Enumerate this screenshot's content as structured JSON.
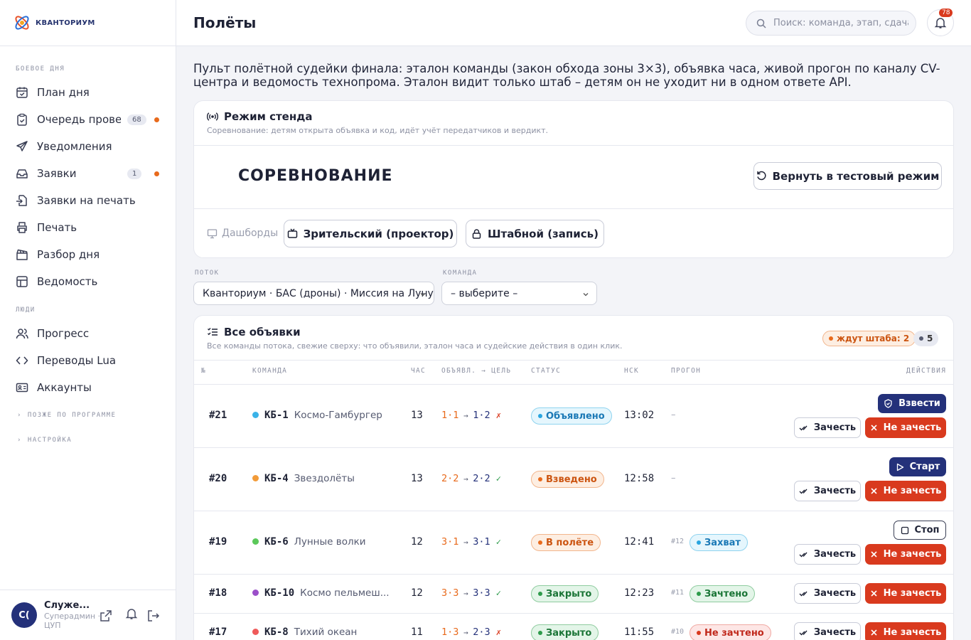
{
  "brand": {
    "name": "КВАНТОРИУМ"
  },
  "sidebar": {
    "section1": "БОЕВОЕ ДНЯ",
    "items1": [
      {
        "label": "План дня",
        "icon": "calendar-check-icon"
      },
      {
        "label": "Очередь проверок",
        "icon": "clipboard-check-icon",
        "count": "68",
        "dot": true
      },
      {
        "label": "Уведомления",
        "icon": "send-icon"
      },
      {
        "label": "Заявки",
        "icon": "inbox-icon",
        "count": "1",
        "dot": true
      },
      {
        "label": "Заявки на печать",
        "icon": "file-import-icon"
      },
      {
        "label": "Печать",
        "icon": "printer-icon"
      },
      {
        "label": "Разбор дня",
        "icon": "clapperboard-icon"
      },
      {
        "label": "Ведомость",
        "icon": "table-icon"
      }
    ],
    "section2": "ЛЮДИ",
    "items2": [
      {
        "label": "Прогресс",
        "icon": "users-icon"
      },
      {
        "label": "Переводы Lua",
        "icon": "code-icon"
      },
      {
        "label": "Аккаунты",
        "icon": "id-card-icon"
      }
    ],
    "collapsed": [
      "ПОЗЖЕ ПО ПРОГРАММЕ",
      "НАСТРОЙКА"
    ],
    "user": {
      "initials": "С(",
      "name": "Служе...",
      "role": "Суперадмин · ЦУП"
    }
  },
  "header": {
    "title": "Полёты",
    "search_placeholder": "Поиск: команда, этап, сдача",
    "notifications": "78"
  },
  "intro": "Пульт полётной судейки финала: эталон команды (закон обхода зоны 3×3), объявка часа, живой прогон по каналу CV-центра и ведомость технопрома. Эталон видит только штаб – детям он не уходит ни в одном ответе API.",
  "mode": {
    "title": "Режим стенда",
    "subtitle": "Соревнование: детям открыта объявка и код, идёт учёт передатчиков и вердикт.",
    "current": "СОРЕВНОВАНИЕ",
    "switch_label": "Вернуть в тестовый режим",
    "dashboards_label": "Дашборды",
    "dash_btn1": "Зрительский (проектор)",
    "dash_btn2": "Штабной (запись)"
  },
  "filters": {
    "stream_label": "ПОТОК",
    "stream_value": "Кванториум · БАС (дроны) · Миссия на Луну",
    "team_label": "КОМАНДА",
    "team_value": "– выберите –"
  },
  "table": {
    "title": "Все объявки",
    "subtitle": "Все команды потока, свежие сверху: что объявили, эталон часа и судейские действия в один клик.",
    "waiting_chip": "ждут штаба: 2",
    "count_chip": "5",
    "columns": [
      "№",
      "КОМАНДА",
      "ЧАС",
      "ОБЪЯВЛ. → ЦЕЛЬ",
      "СТАТУС",
      "НСК",
      "ПРОГОН",
      "ДЕЙСТВИЯ"
    ],
    "accept_label": "Зачесть",
    "reject_label": "Не зачесть",
    "rows": [
      {
        "num": "#21",
        "code": "КБ-1",
        "name": "Космо-Гамбургер",
        "color": "#3bb3e8",
        "hour": "13",
        "decl": "1·1",
        "target": "1·2",
        "mark": "✗",
        "status": "Объявлено",
        "status_class": "st-blue",
        "time": "13:02",
        "run": "–",
        "run_num": "",
        "run_status": "",
        "run_class": "",
        "action": "Взвести",
        "action_kind": "arm"
      },
      {
        "num": "#20",
        "code": "КБ-4",
        "name": "Звездолёты",
        "color": "#f29b38",
        "hour": "13",
        "decl": "2·2",
        "target": "2·2",
        "mark": "✓",
        "status": "Взведено",
        "status_class": "st-orange",
        "time": "12:58",
        "run": "–",
        "run_num": "",
        "run_status": "",
        "run_class": "",
        "action": "Старт",
        "action_kind": "start"
      },
      {
        "num": "#19",
        "code": "КБ-6",
        "name": "Лунные волки",
        "color": "#5bc85a",
        "hour": "12",
        "decl": "3·1",
        "target": "3·1",
        "mark": "✓",
        "status": "В полёте",
        "status_class": "st-orange",
        "time": "12:41",
        "run": "",
        "run_num": "#12",
        "run_status": "Захват",
        "run_class": "st-blue",
        "action": "Стоп",
        "action_kind": "stop"
      },
      {
        "num": "#18",
        "code": "КБ-10",
        "name": "Космо пельмеш...",
        "color": "#9b4fc9",
        "hour": "12",
        "decl": "3·3",
        "target": "3·3",
        "mark": "✓",
        "status": "Закрыто",
        "status_class": "st-green",
        "time": "12:23",
        "run": "",
        "run_num": "#11",
        "run_status": "Зачтено",
        "run_class": "st-green",
        "action": "",
        "action_kind": ""
      },
      {
        "num": "#17",
        "code": "КБ-8",
        "name": "Тихий океан",
        "color": "#ef5a5a",
        "hour": "11",
        "decl": "1·3",
        "target": "2·3",
        "mark": "✗",
        "status": "Закрыто",
        "status_class": "st-green",
        "time": "11:55",
        "run": "",
        "run_num": "#10",
        "run_status": "Не зачтено",
        "run_class": "st-red",
        "action": "",
        "action_kind": ""
      }
    ]
  },
  "colors": {
    "navy": "#24317a",
    "red": "#d93a1e",
    "orange": "#e86a1c",
    "green": "#2d9b4a"
  }
}
